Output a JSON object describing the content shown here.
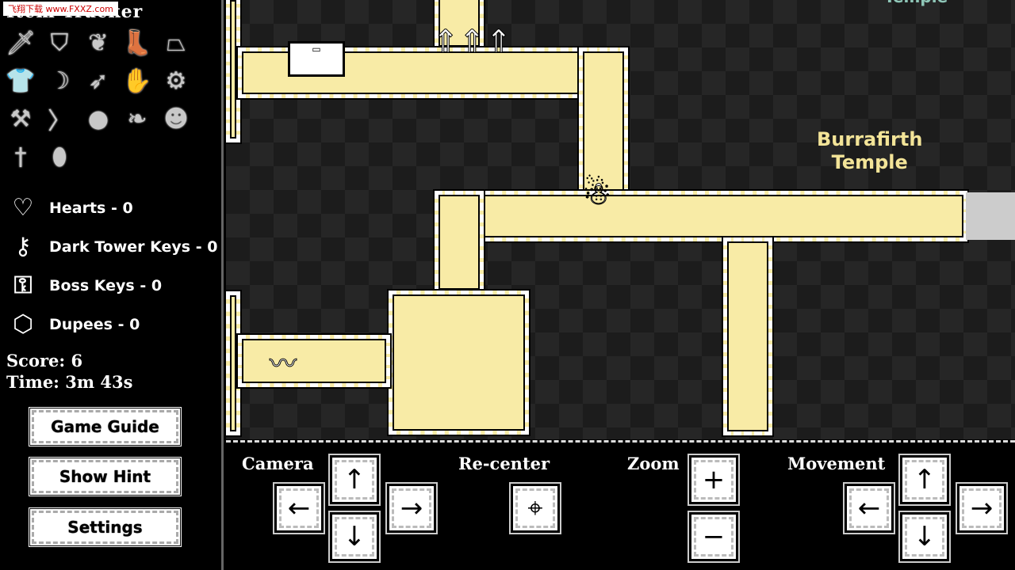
{
  "watermark": "飞翔下载 www.FXXZ.com",
  "sidebar": {
    "title": "Item Tracker",
    "items": [
      {
        "icon": "sword-icon",
        "glyph": "🗡"
      },
      {
        "icon": "shield-icon",
        "glyph": "⛉"
      },
      {
        "icon": "leaves-icon",
        "glyph": "❦"
      },
      {
        "icon": "boots-icon",
        "glyph": "👢"
      },
      {
        "icon": "skirt-icon",
        "glyph": "⏢"
      },
      {
        "icon": "tunic-icon",
        "glyph": "👕"
      },
      {
        "icon": "bow-icon",
        "glyph": "☽"
      },
      {
        "icon": "arrow-icon",
        "glyph": "➶"
      },
      {
        "icon": "glove-icon",
        "glyph": "✋"
      },
      {
        "icon": "drill-icon",
        "glyph": "⚙"
      },
      {
        "icon": "hammer-icon",
        "glyph": "⚒"
      },
      {
        "icon": "boomerang-icon",
        "glyph": "〉"
      },
      {
        "icon": "bomb-icon",
        "glyph": "●"
      },
      {
        "icon": "leaf-fan-icon",
        "glyph": "❧"
      },
      {
        "icon": "mask-icon",
        "glyph": "☻"
      },
      {
        "icon": "dagger-icon",
        "glyph": "†"
      },
      {
        "icon": "seed-icon",
        "glyph": "⬮"
      }
    ],
    "stats": [
      {
        "icon": "heart-icon",
        "glyph": "♡",
        "label": "Hearts - 0"
      },
      {
        "icon": "dark-tower-key-icon",
        "glyph": "⚷",
        "label": "Dark Tower Keys - 0"
      },
      {
        "icon": "boss-key-icon",
        "glyph": "⚿",
        "label": "Boss Keys - 0"
      },
      {
        "icon": "dupee-gem-icon",
        "glyph": "⬡",
        "label": "Dupees - 0"
      }
    ],
    "score": "Score: 6",
    "time": "Time: 3m 43s",
    "buttons": [
      "Game Guide",
      "Show Hint",
      "Settings"
    ]
  },
  "map": {
    "labels": [
      "Burrafirth\nTemple",
      "Temple"
    ]
  },
  "controls": {
    "camera": "Camera",
    "recenter": "Re-center",
    "zoom": "Zoom",
    "movement": "Movement",
    "up": "↑",
    "down": "↓",
    "left": "←",
    "right": "→",
    "plus": "+",
    "minus": "−",
    "center": "⌖"
  }
}
